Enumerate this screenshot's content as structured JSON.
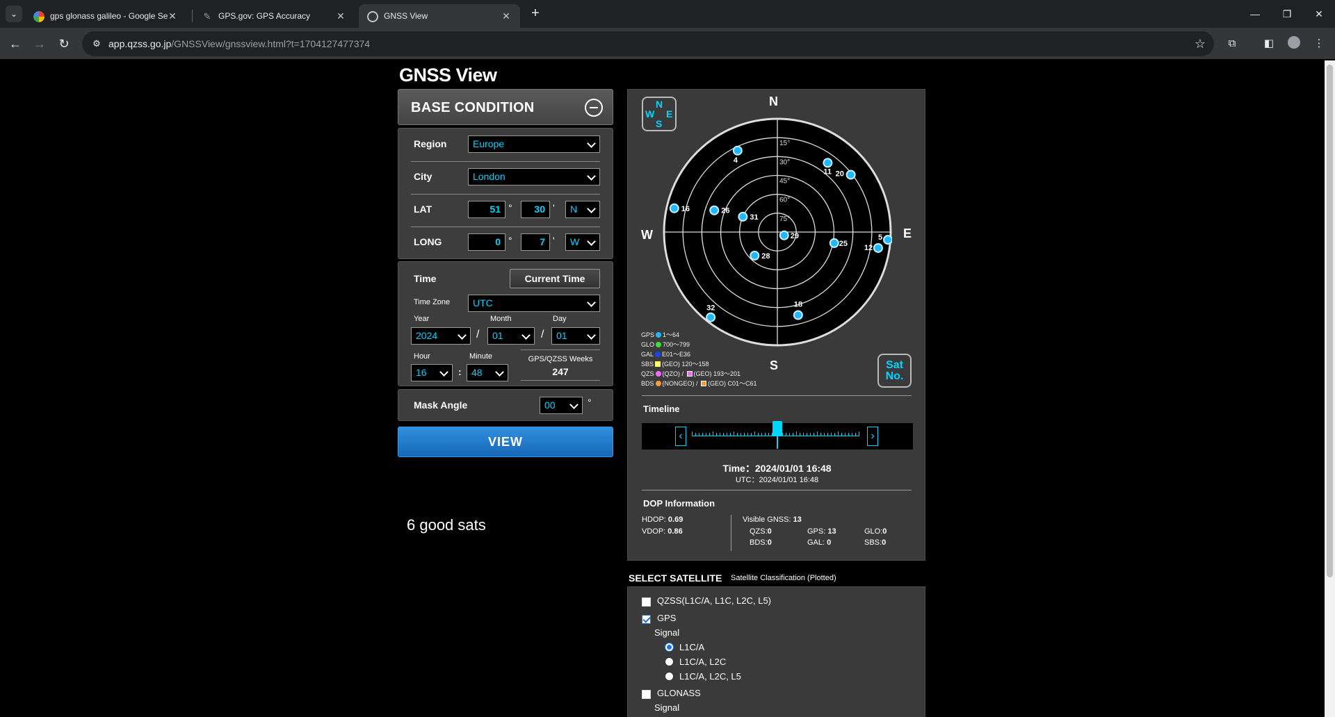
{
  "browser": {
    "tabs": [
      {
        "title": "gps glonass galileo - Google Se",
        "icon": "google-icon"
      },
      {
        "title": "GPS.gov: GPS Accuracy",
        "icon": "satellite-icon"
      },
      {
        "title": "GNSS View",
        "icon": "globe-icon"
      }
    ],
    "url_host": "app.qzss.go.jp",
    "url_path": "/GNSSView/gnssview.html?t=1704127477374"
  },
  "page": {
    "title": "GNSS View",
    "base_condition": {
      "header": "BASE CONDITION",
      "region_label": "Region",
      "region_value": "Europe",
      "city_label": "City",
      "city_value": "London",
      "lat_label": "LAT",
      "lat_deg": "51",
      "lat_min": "30",
      "lat_dir": "N",
      "long_label": "LONG",
      "long_deg": "0",
      "long_min": "7",
      "long_dir": "W",
      "deg_sym": "°",
      "min_sym": "'",
      "time_label": "Time",
      "current_time_button": "Current Time",
      "timezone_label": "Time Zone",
      "timezone_value": "UTC",
      "year_label": "Year",
      "year_value": "2024",
      "month_label": "Month",
      "month_value": "01",
      "day_label": "Day",
      "day_value": "01",
      "date_sep": "/",
      "hour_label": "Hour",
      "hour_value": "16",
      "minute_label": "Minute",
      "minute_value": "48",
      "time_sep": ":",
      "weeks_label": "GPS/QZSS Weeks",
      "weeks_value": "247",
      "mask_label": "Mask Angle",
      "mask_value": "00",
      "view_button": "VIEW"
    },
    "note": "6 good sats",
    "skyplot": {
      "compass": {
        "n": "N",
        "s": "S",
        "e": "E",
        "w": "W"
      },
      "directions": {
        "n": "N",
        "s": "S",
        "e": "E",
        "w": "W"
      },
      "elevation_labels": [
        "15°",
        "30°",
        "45°",
        "60°",
        "75°"
      ],
      "satellites": [
        {
          "id": "4",
          "az": 334,
          "el": 18
        },
        {
          "id": "11",
          "az": 36,
          "el": 22
        },
        {
          "id": "20",
          "az": 52,
          "el": 16
        },
        {
          "id": "16",
          "az": 283,
          "el": 6
        },
        {
          "id": "26",
          "az": 289,
          "el": 37
        },
        {
          "id": "31",
          "az": 294,
          "el": 60
        },
        {
          "id": "29",
          "az": 116,
          "el": 84
        },
        {
          "id": "25",
          "az": 101,
          "el": 44
        },
        {
          "id": "5",
          "az": 94,
          "el": 2
        },
        {
          "id": "12",
          "az": 99,
          "el": 9
        },
        {
          "id": "28",
          "az": 224,
          "el": 64
        },
        {
          "id": "18",
          "az": 166,
          "el": 22
        },
        {
          "id": "32",
          "az": 218,
          "el": 4
        }
      ],
      "legend": [
        {
          "sys": "GPS",
          "color": "#1fb8ff",
          "text": "1～64"
        },
        {
          "sys": "GLO",
          "color": "#39e039",
          "text": "700～799"
        },
        {
          "sys": "GAL",
          "color": "#2040ff",
          "text": "E01～E36"
        },
        {
          "sys": "SBS",
          "color": "#ffff66",
          "text": "(GEO) 120～158"
        },
        {
          "sys": "QZS",
          "color": "#ff66ff",
          "text": "(QZO) / ",
          "text2": "(GEO) 193～201"
        },
        {
          "sys": "BDS",
          "color": "#ff9933",
          "text": "(NONGEO) / ",
          "text2": "(GEO) C01～C61"
        }
      ],
      "sat_no_button_line1": "Sat",
      "sat_no_button_line2": "No."
    },
    "timeline": {
      "title": "Timeline",
      "time_main": "Time：2024/01/01 16:48",
      "time_utc": "UTC：2024/01/01 16:48"
    },
    "dop": {
      "title": "DOP Information",
      "hdop_label": "HDOP:",
      "hdop_value": "0.69",
      "vdop_label": "VDOP:",
      "vdop_value": "0.86",
      "visible_label": "Visible GNSS:",
      "visible_value": "13",
      "qzs_label": "QZS:",
      "qzs_value": "0",
      "gps_label": "GPS:",
      "gps_value": "13",
      "glo_label": "GLO:",
      "glo_value": "0",
      "bds_label": "BDS:",
      "bds_value": "0",
      "gal_label": "GAL:",
      "gal_value": "0",
      "sbs_label": "SBS:",
      "sbs_value": "0"
    },
    "select_satellite": {
      "title": "SELECT SATELLITE",
      "subtitle": "Satellite Classification (Plotted)",
      "qzss_label": "QZSS(L1C/A, L1C, L2C, L5)",
      "gps_label": "GPS",
      "signal_label": "Signal",
      "gps_signals": [
        "L1C/A",
        "L1C/A, L2C",
        "L1C/A, L2C, L5"
      ],
      "glonass_label": "GLONASS",
      "glonass_signal_label": "Signal"
    }
  }
}
